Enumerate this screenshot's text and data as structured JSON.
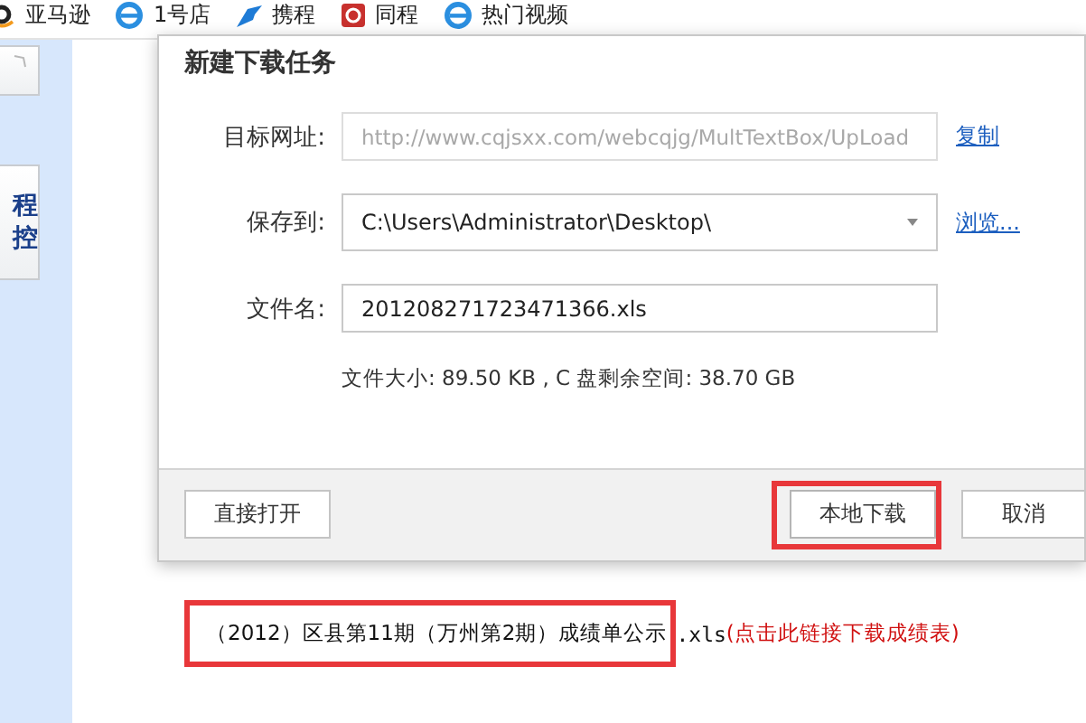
{
  "bookmarks": [
    {
      "kind": "amazon",
      "label": "亚马逊"
    },
    {
      "kind": "ie",
      "label": "1号店"
    },
    {
      "kind": "bird",
      "label": "携程"
    },
    {
      "kind": "swirl",
      "label": "同程"
    },
    {
      "kind": "ie",
      "label": "热门视频"
    }
  ],
  "sidebar": {
    "card_text": [
      "程",
      "控"
    ]
  },
  "dialog": {
    "title": "新建下载任务",
    "fields": [
      {
        "kind": "text",
        "label": "目标网址:",
        "value": "http://www.cqjsxx.com/webcqjg/MultTextBox/UpLoad",
        "disabled": true,
        "link": "复制"
      },
      {
        "kind": "dropdown",
        "label": "保存到:",
        "value": "C:\\Users\\Administrator\\Desktop\\",
        "disabled": false,
        "link": "浏览..."
      },
      {
        "kind": "text",
        "label": "文件名:",
        "value": "201208271723471366.xls",
        "disabled": false
      }
    ],
    "info": "文件大小: 89.50 KB , C 盘剩余空间: 38.70 GB",
    "buttons": [
      {
        "label": "直接打开",
        "highlighted": false
      },
      {
        "label": "本地下载",
        "highlighted": true
      },
      {
        "label": "取消",
        "highlighted": false
      }
    ]
  },
  "page": {
    "link_text": "（2012）区县第11期（万州第2期）成绩单公示",
    "ext": ".xls",
    "hint": "(点击此链接下载成绩表)",
    "highlighted": true
  }
}
